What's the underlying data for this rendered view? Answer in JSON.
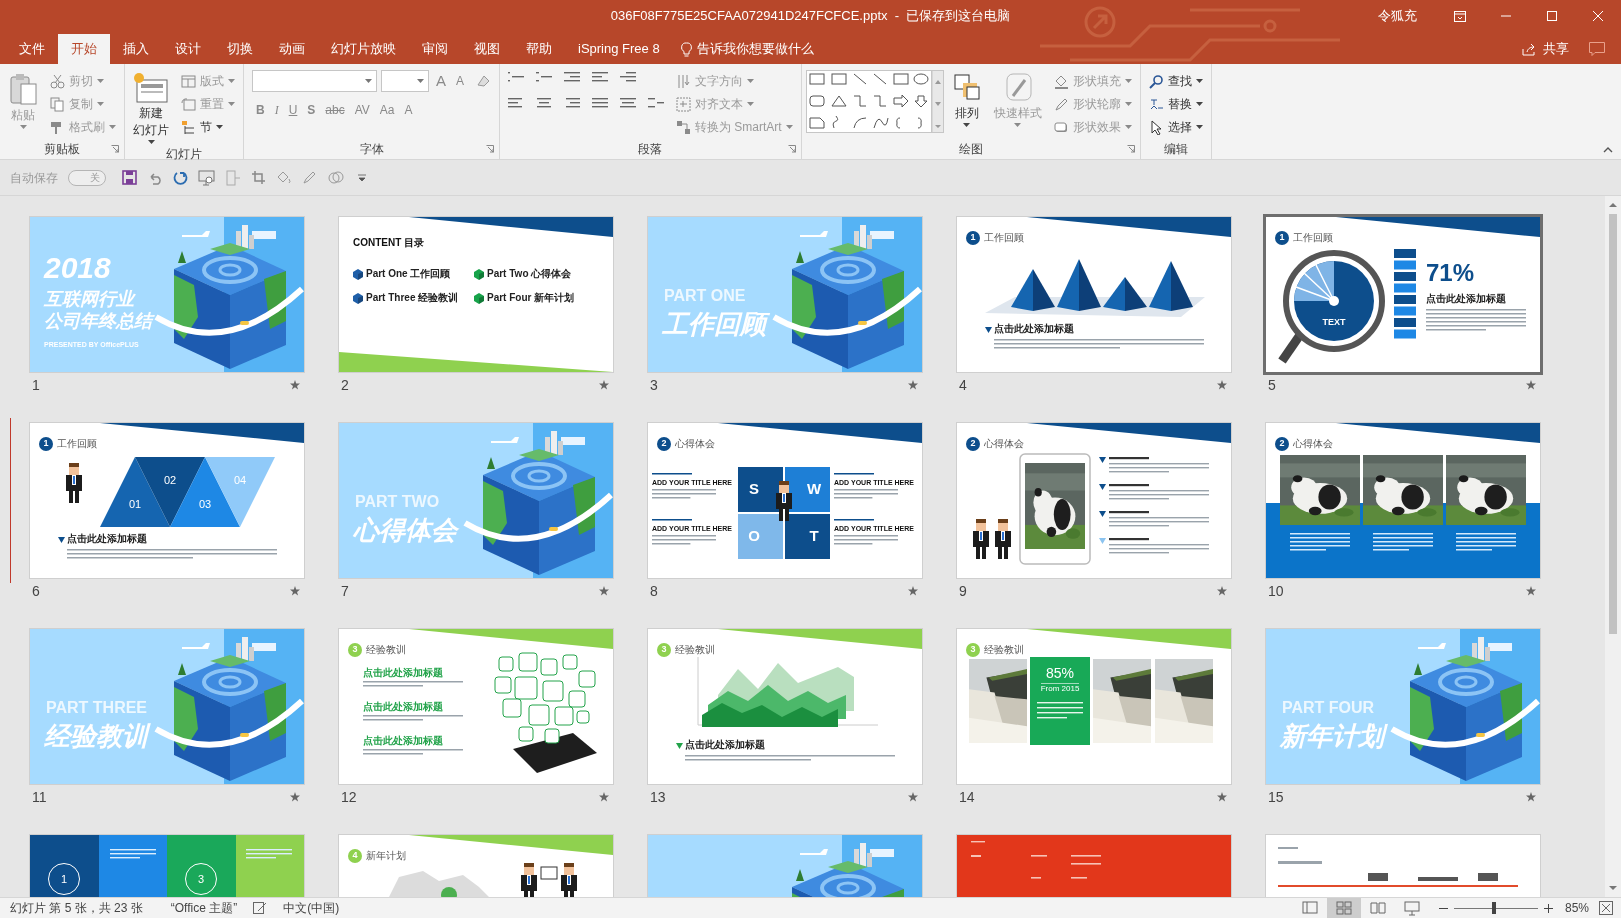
{
  "window": {
    "title": "036F08F775E25CFAA072941D247FCFCE.pptx  -  已保存到这台电脑",
    "user": "令狐充"
  },
  "tabs": [
    {
      "label": "文件",
      "selected": false
    },
    {
      "label": "开始",
      "selected": true
    },
    {
      "label": "插入",
      "selected": false
    },
    {
      "label": "设计",
      "selected": false
    },
    {
      "label": "切换",
      "selected": false
    },
    {
      "label": "动画",
      "selected": false
    },
    {
      "label": "幻灯片放映",
      "selected": false
    },
    {
      "label": "审阅",
      "selected": false
    },
    {
      "label": "视图",
      "selected": false
    },
    {
      "label": "帮助",
      "selected": false
    },
    {
      "label": "iSpring Free 8",
      "selected": false
    }
  ],
  "tell_me": "告诉我你想要做什么",
  "share": "共享",
  "ribbon": [
    {
      "label": "剪贴板",
      "kind": "standard",
      "launcher": true,
      "commands": [
        {
          "label_lines": [
            "粘贴"
          ],
          "kind": "large",
          "disabled": true
        },
        {
          "label": "剪切",
          "kind": "small",
          "disabled": true
        },
        {
          "label": "复制",
          "kind": "small",
          "disabled": true
        },
        {
          "label": "格式刷",
          "kind": "small",
          "disabled": true
        }
      ]
    },
    {
      "label": "幻灯片",
      "kind": "standard",
      "launcher": false,
      "commands": [
        {
          "label_lines": [
            "新建",
            "幻灯片"
          ],
          "kind": "large",
          "disabled": false
        },
        {
          "label": "版式",
          "kind": "small",
          "disabled": true
        },
        {
          "label": "重置",
          "kind": "small",
          "disabled": true
        },
        {
          "label": "节",
          "kind": "small",
          "disabled": false
        }
      ]
    },
    {
      "label": "字体",
      "kind": "font",
      "launcher": true,
      "size_buttons": [
        "A",
        "A"
      ],
      "font_buttons": [
        "B",
        "I",
        "U",
        "S",
        "abc",
        "AV",
        "Aa",
        "A"
      ]
    },
    {
      "label": "段落",
      "kind": "paragraph",
      "launcher": true,
      "commands": [
        {
          "label": "文字方向",
          "kind": "small",
          "disabled": true
        },
        {
          "label": "对齐文本",
          "kind": "small",
          "disabled": true
        },
        {
          "label": "转换为 SmartArt",
          "kind": "small",
          "disabled": true
        }
      ]
    },
    {
      "label": "绘图",
      "kind": "drawing",
      "launcher": true,
      "commands": [
        {
          "label_lines": [
            "排列"
          ],
          "kind": "large",
          "disabled": false
        },
        {
          "label_lines": [
            "快速样式"
          ],
          "kind": "large",
          "disabled": true
        },
        {
          "label": "形状填充",
          "kind": "small",
          "disabled": true
        },
        {
          "label": "形状轮廓",
          "kind": "small",
          "disabled": true
        },
        {
          "label": "形状效果",
          "kind": "small",
          "disabled": true
        }
      ]
    },
    {
      "label": "编辑",
      "kind": "standard",
      "launcher": false,
      "commands": [
        {
          "label": "查找",
          "kind": "small",
          "disabled": false
        },
        {
          "label": "替换",
          "kind": "small",
          "disabled": false
        },
        {
          "label": "选择",
          "kind": "small",
          "disabled": false
        }
      ]
    }
  ],
  "quick_access": {
    "autosave_label": "自动保存",
    "autosave_state": "关",
    "autosave_on": false
  },
  "slides": [
    {
      "number": "1",
      "kind": "cover",
      "selected": false,
      "transition": true,
      "title_lines": [
        "2018",
        "互联网行业",
        "公司年终总结"
      ],
      "byline": "PRESENTED BY OfficePLUS"
    },
    {
      "number": "2",
      "kind": "contents",
      "selected": false,
      "transition": true,
      "heading": "CONTENT 目录",
      "items": [
        {
          "label": "Part One 工作回顾",
          "color": "#1f5fa8"
        },
        {
          "label": "Part Two 心得体会",
          "color": "#17a34a"
        },
        {
          "label": "Part Three 经验教训",
          "color": "#1f5fa8"
        },
        {
          "label": "Part Four 新年计划",
          "color": "#17a34a"
        }
      ]
    },
    {
      "number": "3",
      "kind": "section",
      "selected": false,
      "transition": true,
      "part": "PART ONE",
      "title": "工作回顾"
    },
    {
      "number": "4",
      "kind": "pyramids",
      "selected": false,
      "transition": true,
      "color": "#0d4e8c",
      "badge": "1",
      "section": "工作回顾",
      "heading": "点击此处添加标题"
    },
    {
      "number": "5",
      "kind": "magnifier",
      "selected": true,
      "transition": true,
      "color": "#0d4e8c",
      "badge": "1",
      "section": "工作回顾",
      "label": "TEXT",
      "percent": "71%",
      "heading": "点击此处添加标题"
    },
    {
      "number": "6",
      "kind": "triangles",
      "selected": false,
      "transition": true,
      "color": "#0d4e8c",
      "badge": "1",
      "section": "工作回顾",
      "steps": [
        "01",
        "02",
        "03",
        "04"
      ],
      "heading": "点击此处添加标题"
    },
    {
      "number": "7",
      "kind": "section",
      "selected": false,
      "transition": true,
      "part": "PART TWO",
      "title": "心得体会"
    },
    {
      "number": "8",
      "kind": "swot",
      "selected": false,
      "transition": true,
      "color": "#0d4e8c",
      "badge": "2",
      "section": "心得体会",
      "letters": [
        "S",
        "W",
        "O",
        "T"
      ],
      "captions": [
        "ADD YOUR TITLE HERE",
        "ADD YOUR TITLE HERE",
        "ADD YOUR TITLE HERE",
        "ADD YOUR TITLE HERE"
      ]
    },
    {
      "number": "9",
      "kind": "tablet",
      "selected": false,
      "transition": true,
      "color": "#0d4e8c",
      "badge": "2",
      "section": "心得体会"
    },
    {
      "number": "10",
      "kind": "photos",
      "selected": false,
      "transition": true,
      "color": "#0d4e8c",
      "badge": "2",
      "section": "心得体会"
    },
    {
      "number": "11",
      "kind": "section",
      "selected": false,
      "transition": true,
      "part": "PART THREE",
      "title": "经验教训"
    },
    {
      "number": "12",
      "kind": "bubbles",
      "selected": false,
      "transition": true,
      "color": "#8fd14f",
      "badge": "3",
      "section": "经验教训",
      "headings": [
        "点击此处添加标题",
        "点击此处添加标题",
        "点击此处添加标题"
      ]
    },
    {
      "number": "13",
      "kind": "area",
      "selected": false,
      "transition": true,
      "color": "#8fd14f",
      "badge": "3",
      "section": "经验教训",
      "heading": "点击此处添加标题"
    },
    {
      "number": "14",
      "kind": "waterfalls",
      "selected": false,
      "transition": true,
      "color": "#8fd14f",
      "badge": "3",
      "section": "经验教训",
      "percent": "85%",
      "since": "From 2015"
    },
    {
      "number": "15",
      "kind": "section",
      "selected": false,
      "transition": true,
      "part": "PART FOUR",
      "title": "新年计划"
    },
    {
      "kind": "circles",
      "selected": false,
      "steps": [
        "1",
        "3"
      ]
    },
    {
      "kind": "people",
      "selected": false,
      "color": "#8fd14f",
      "badge": "4",
      "section": "新年计划"
    },
    {
      "kind": "globe",
      "selected": false
    },
    {
      "kind": "red",
      "selected": false
    },
    {
      "kind": "document",
      "selected": false
    }
  ],
  "status_bar": {
    "slide_info": "幻灯片 第 5 张，共 23 张",
    "theme": "“Office 主题”",
    "language": "中文(中国)",
    "views": [
      {
        "selected": false
      },
      {
        "selected": true
      },
      {
        "selected": false
      },
      {
        "selected": false
      }
    ],
    "zoom": {
      "level": 0.47,
      "reading": "85%"
    }
  }
}
